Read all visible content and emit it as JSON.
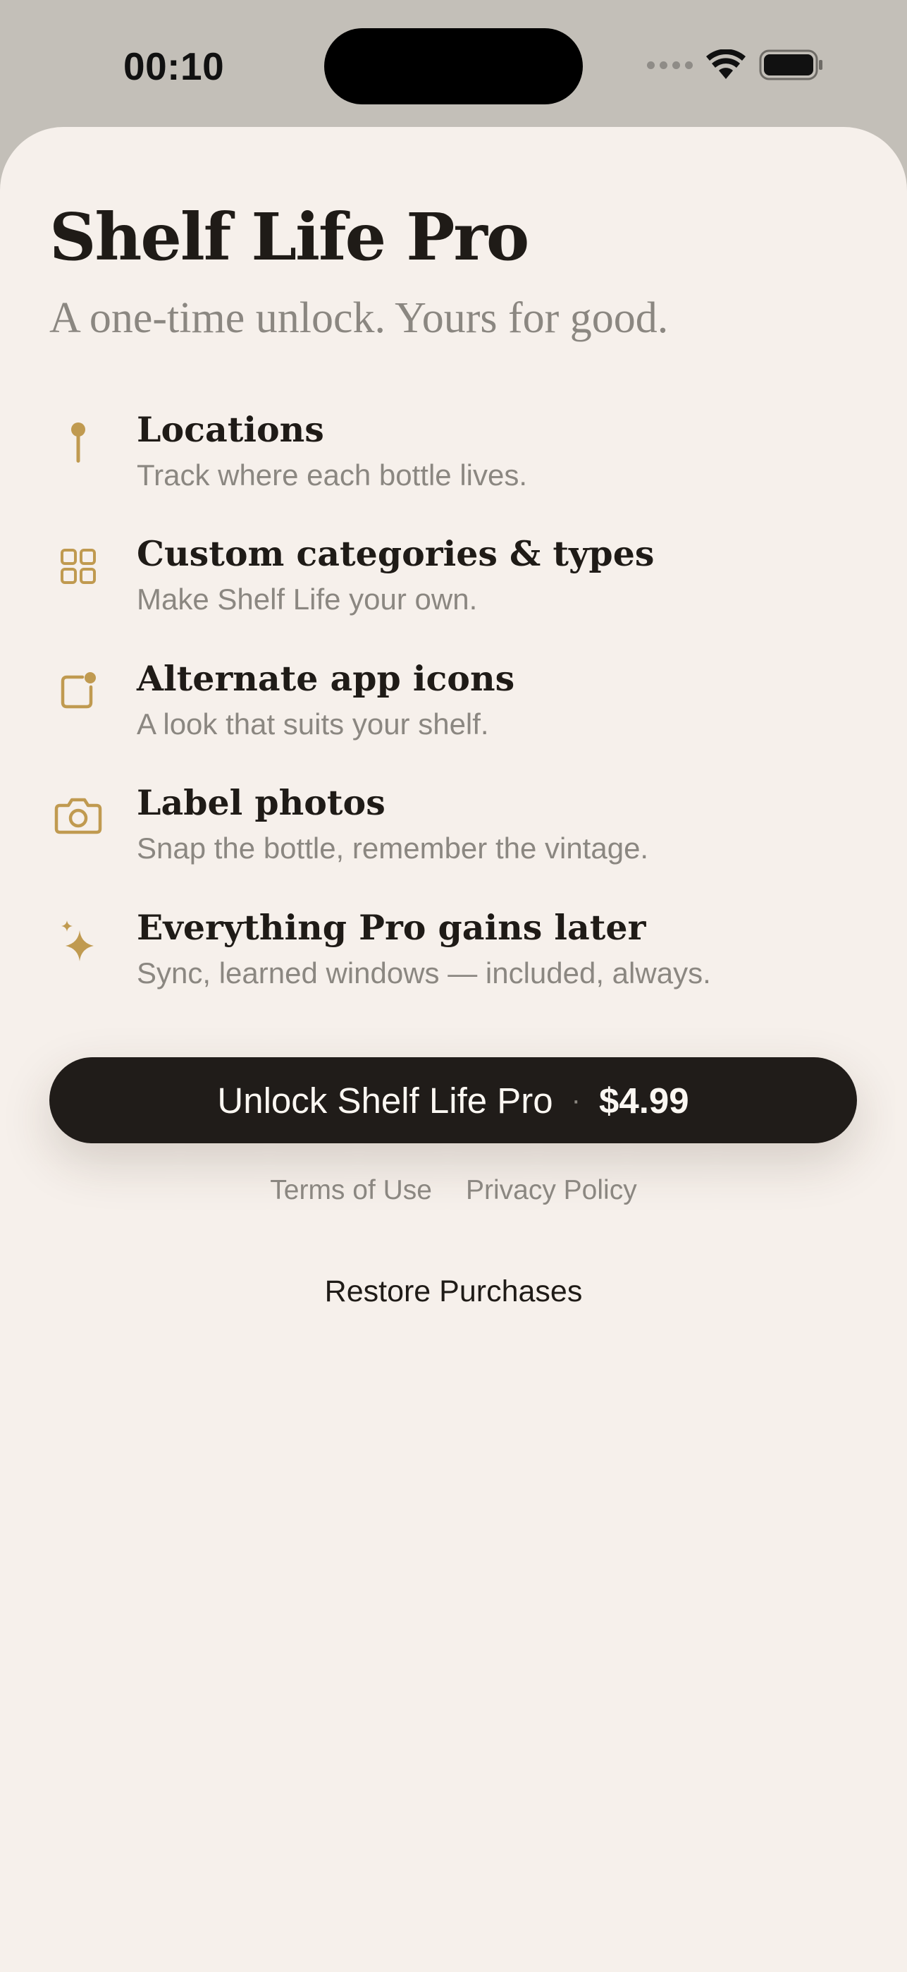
{
  "status_bar": {
    "time": "00:10",
    "icons": [
      "signal-dots-icon",
      "wifi-icon",
      "battery-icon"
    ]
  },
  "header": {
    "title": "Shelf Life Pro",
    "subtitle": "A one-time unlock. Yours for good."
  },
  "features": [
    {
      "icon": "location-pin-icon",
      "title": "Locations",
      "description": "Track where each bottle lives."
    },
    {
      "icon": "grid-icon",
      "title": "Custom categories & types",
      "description": "Make Shelf Life your own."
    },
    {
      "icon": "app-icon-icon",
      "title": "Alternate app icons",
      "description": "A look that suits your shelf."
    },
    {
      "icon": "camera-icon",
      "title": "Label photos",
      "description": "Snap the bottle, remember the vintage."
    },
    {
      "icon": "sparkles-icon",
      "title": "Everything Pro gains later",
      "description": "Sync, learned windows — included, always."
    }
  ],
  "purchase": {
    "button_label": "Unlock Shelf Life Pro",
    "separator": "·",
    "price": "$4.99"
  },
  "legal": {
    "terms": "Terms of Use",
    "privacy": "Privacy Policy"
  },
  "restore_label": "Restore Purchases",
  "colors": {
    "accent": "#c09a50",
    "background": "#f6f0eb",
    "button": "#201c19",
    "text_primary": "#1f1b17",
    "text_secondary": "#8b8781",
    "status_bar_bg": "#c3bfb8"
  }
}
